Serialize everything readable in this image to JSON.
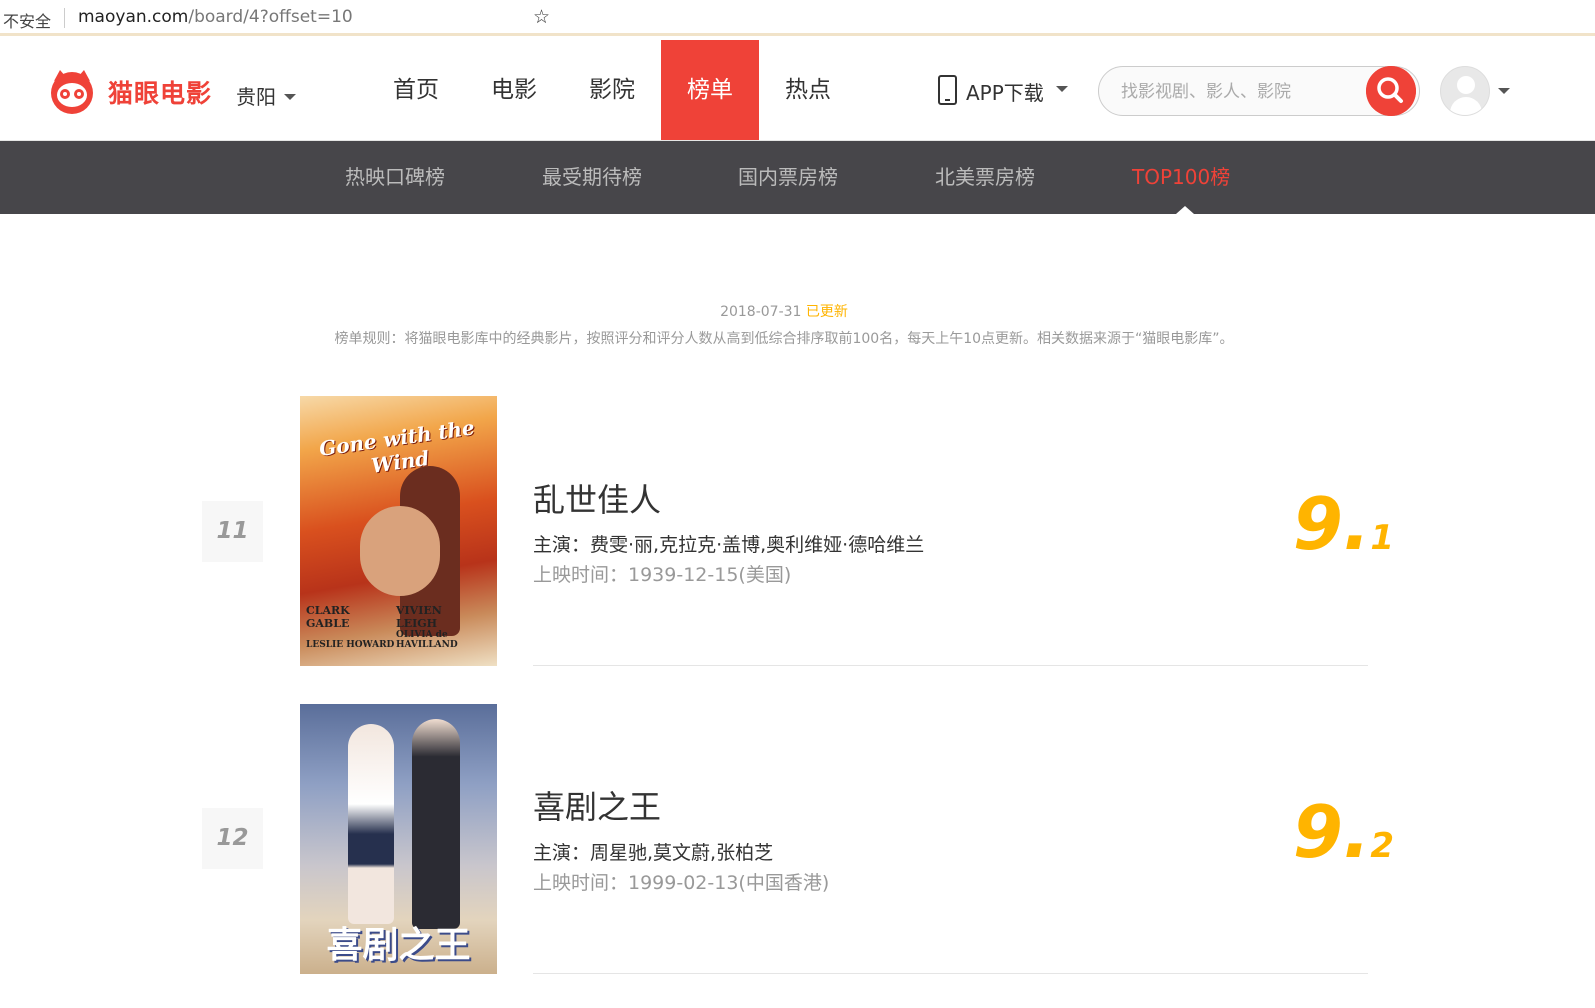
{
  "browser": {
    "security": "不安全",
    "url_host": "maoyan.com",
    "url_path": "/board/4?offset=10"
  },
  "header": {
    "logo_text": "猫眼电影",
    "city": "贵阳",
    "nav": [
      "首页",
      "电影",
      "影院",
      "榜单",
      "热点"
    ],
    "active_nav": "榜单",
    "app_download": "APP下载",
    "search_placeholder": "找影视剧、影人、影院"
  },
  "subnav": {
    "items": [
      "热映口碑榜",
      "最受期待榜",
      "国内票房榜",
      "北美票房榜",
      "TOP100榜"
    ],
    "active": "TOP100榜"
  },
  "board": {
    "date": "2018-07-31",
    "updated": "已更新",
    "rule": "榜单规则：将猫眼电影库中的经典影片，按照评分和评分人数从高到低综合排序取前100名，每天上午10点更新。相关数据来源于“猫眼电影库”。"
  },
  "movies": [
    {
      "rank": "11",
      "title": "乱世佳人",
      "stars": "主演：费雯·丽,克拉克·盖博,奥利维娅·德哈维兰",
      "release": "上映时间：1939-12-15(美国)",
      "score_int": "9.",
      "score_frac": "1",
      "poster_text": "Gone with the Wind",
      "poster_credits": [
        "CLARK GABLE",
        "VIVIEN LEIGH",
        "LESLIE HOWARD",
        "OLIVIA de HAVILLAND"
      ]
    },
    {
      "rank": "12",
      "title": "喜剧之王",
      "stars": "主演：周星驰,莫文蔚,张柏芝",
      "release": "上映时间：1999-02-13(中国香港)",
      "score_int": "9.",
      "score_frac": "2",
      "poster_text": "喜剧之王"
    }
  ],
  "colors": {
    "brand": "#ef4238",
    "score": "#ffb400",
    "subnav_bg": "#47464a"
  }
}
